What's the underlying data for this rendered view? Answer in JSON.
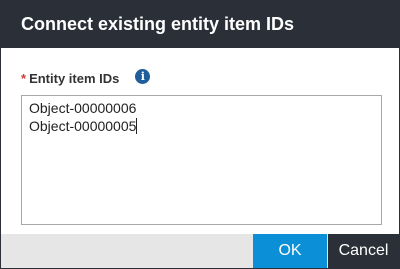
{
  "dialog": {
    "title": "Connect existing entity item IDs"
  },
  "field": {
    "required_marker": "*",
    "label": "Entity item IDs",
    "info_icon": "i",
    "lines": [
      "Object-00000006",
      "Object-00000005"
    ]
  },
  "footer": {
    "ok_label": "OK",
    "cancel_label": "Cancel"
  },
  "colors": {
    "title_bar": "#2b3038",
    "ok_button": "#0b8fd6",
    "cancel_button": "#2b3038",
    "required_star": "#d03b3b",
    "info_icon": "#1f5e9a"
  }
}
